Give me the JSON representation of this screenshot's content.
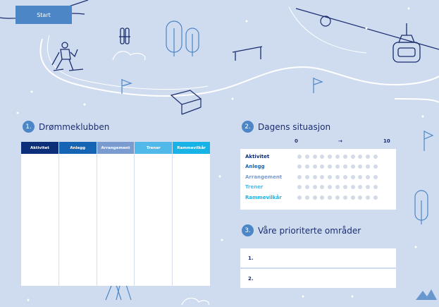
{
  "start_label": "Start",
  "section1": {
    "number": "1.",
    "title": "Drømmeklubben"
  },
  "section2": {
    "number": "2.",
    "title": "Dagens situasjon"
  },
  "section3": {
    "number": "3.",
    "title": "Våre prioriterte områder"
  },
  "club_columns": [
    {
      "label": "Aktivitet",
      "color": "#0d2f7a"
    },
    {
      "label": "Anlegg",
      "color": "#1565b4"
    },
    {
      "label": "Arrangement",
      "color": "#7a9bd0"
    },
    {
      "label": "Trener",
      "color": "#51b9ea"
    },
    {
      "label": "Rammevilkår",
      "color": "#18b3e6"
    }
  ],
  "scale": {
    "min": "0",
    "arrow": "→",
    "max": "10"
  },
  "situation_rows": [
    {
      "label": "Aktivitet",
      "color": "#0d2f7a"
    },
    {
      "label": "Anlegg",
      "color": "#1565b4"
    },
    {
      "label": "Arrangement",
      "color": "#7a9bd0"
    },
    {
      "label": "Trener",
      "color": "#51b9ea"
    },
    {
      "label": "Rammevilkår",
      "color": "#18b3e6"
    }
  ],
  "priorities": [
    "1.",
    "2."
  ]
}
